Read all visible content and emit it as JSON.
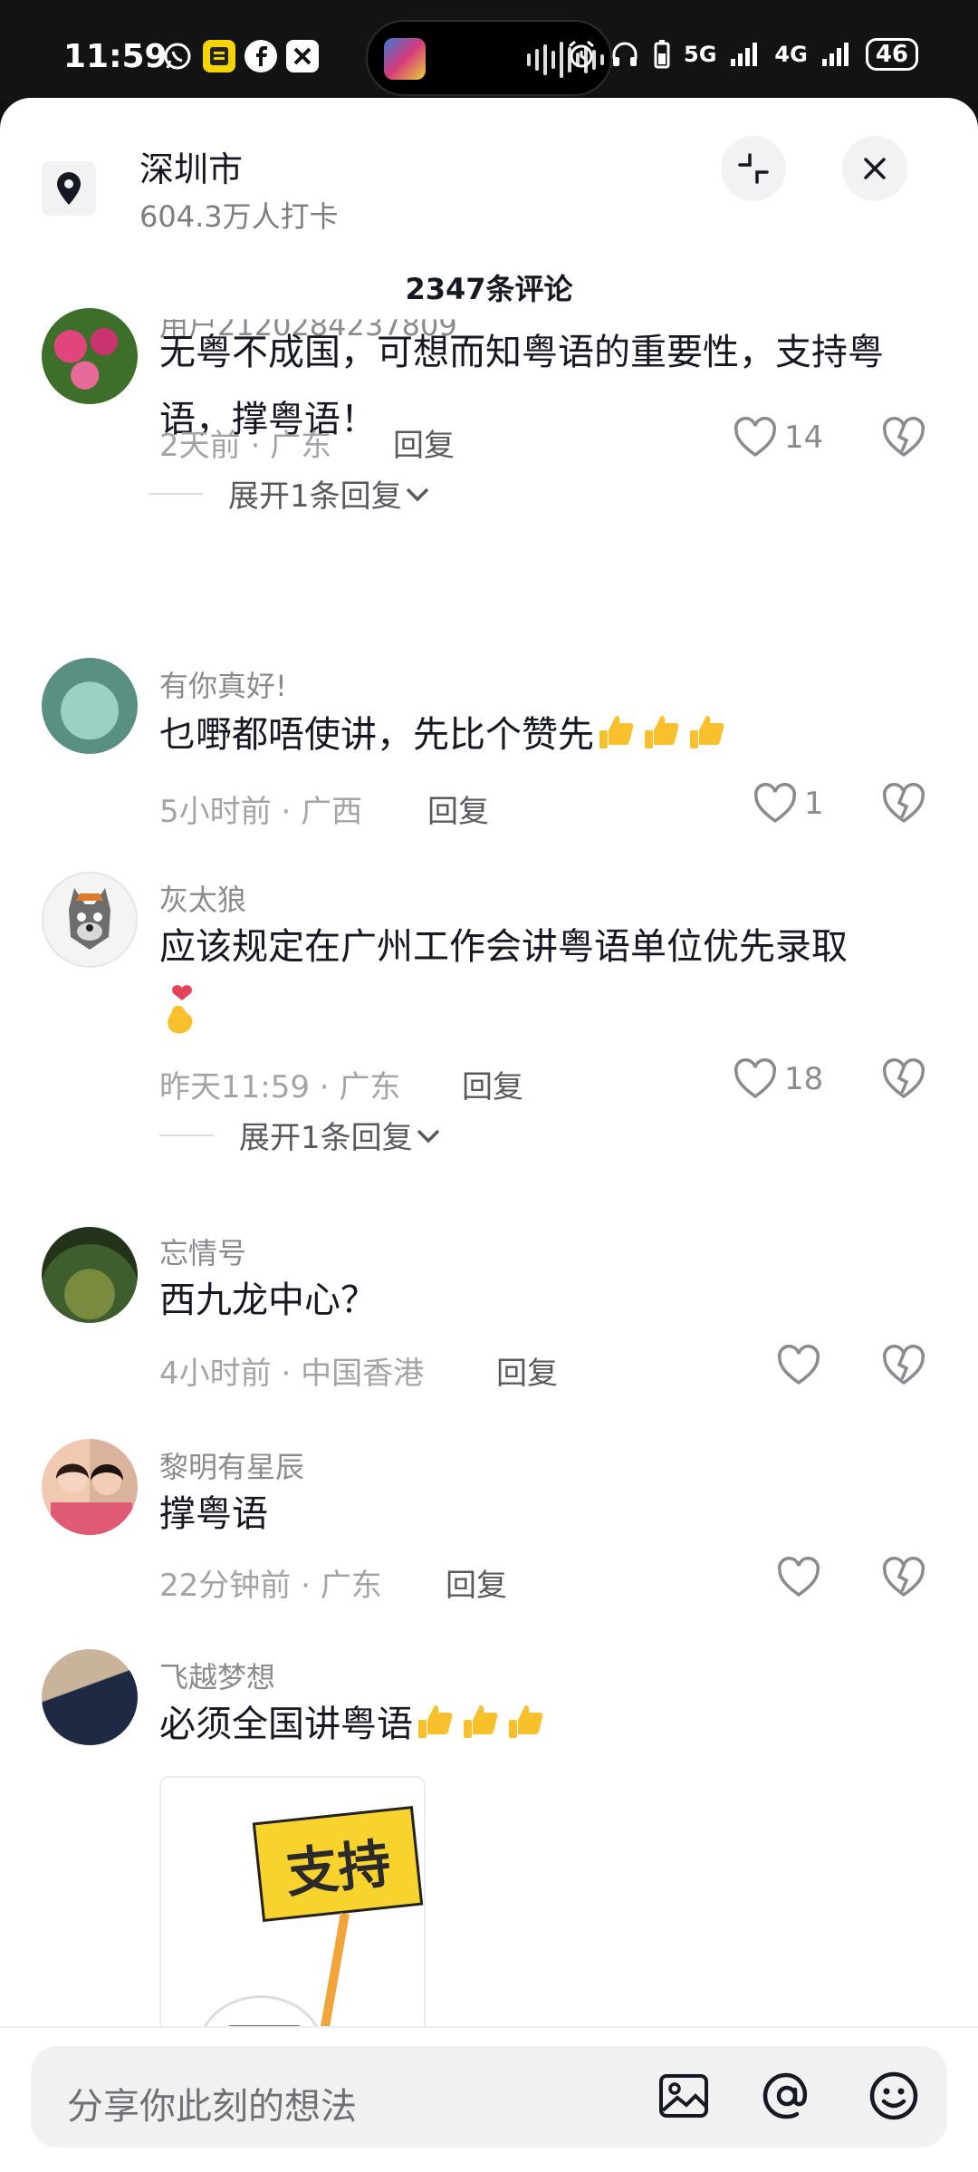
{
  "status_bar": {
    "time": "11:59",
    "net1": "5G",
    "net2": "4G",
    "battery": "46"
  },
  "location": {
    "name": "深圳市",
    "checkins": "604.3万人打卡"
  },
  "comments_title": "2347条评论",
  "comments": [
    {
      "username": "用户2120284237809",
      "text": "无粤不成国，可想而知粤语的重要性，支持粤语，撑粤语！",
      "time": "2天前",
      "region": "广东",
      "reply_label": "回复",
      "likes": "14",
      "expand": "展开1条回复"
    },
    {
      "username": "有你真好!",
      "text": "乜嘢都唔使讲，先比个赞先",
      "time": "5小时前",
      "region": "广西",
      "reply_label": "回复",
      "likes": "1"
    },
    {
      "username": "灰太狼",
      "text": "应该规定在广州工作会讲粤语单位优先录取",
      "time": "昨天11:59",
      "region": "广东",
      "reply_label": "回复",
      "likes": "18",
      "expand": "展开1条回复"
    },
    {
      "username": "忘情号",
      "text": "西九龙中心？",
      "time": "4小时前",
      "region": "中国香港",
      "reply_label": "回复",
      "likes": ""
    },
    {
      "username": "黎明有星辰",
      "text": "撑粤语",
      "time": "22分钟前",
      "region": "广东",
      "reply_label": "回复",
      "likes": ""
    },
    {
      "username": "飞越梦想",
      "text": "必须全国讲粤语",
      "sticker_text": "支持"
    }
  ],
  "input": {
    "placeholder": "分享你此刻的想法"
  },
  "colors": {
    "sheet_bg": "#ffffff",
    "text_primary": "#161823",
    "text_secondary": "#8a8b91"
  },
  "icons": [
    "location-pin-icon",
    "collapse-icon",
    "close-icon",
    "heart-icon",
    "dislike-heart-icon",
    "thumbs-up-emoji",
    "image-icon",
    "at-icon",
    "emoji-icon"
  ]
}
